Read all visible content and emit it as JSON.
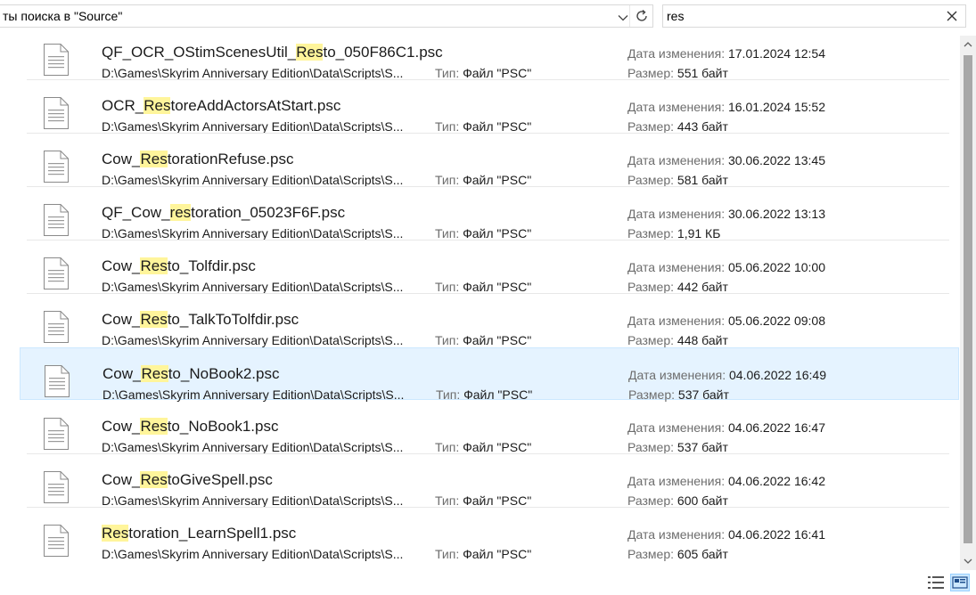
{
  "address": {
    "text": "ты поиска в \"Source\""
  },
  "search": {
    "value": "res"
  },
  "labels": {
    "date": "Дата изменения:",
    "size": "Размер:",
    "type": "Тип:"
  },
  "files": [
    {
      "name_pre": "QF_OCR_OStimScenesUtil_",
      "name_hl": "Res",
      "name_post": "to_050F86C1.psc",
      "path": "D:\\Games\\Skyrim Anniversary Edition\\Data\\Scripts\\S...",
      "type": "Файл \"PSC\"",
      "date": "17.01.2024 12:54",
      "size": "551 байт"
    },
    {
      "name_pre": "OCR_",
      "name_hl": "Res",
      "name_post": "toreAddActorsAtStart.psc",
      "path": "D:\\Games\\Skyrim Anniversary Edition\\Data\\Scripts\\S...",
      "type": "Файл \"PSC\"",
      "date": "16.01.2024 15:52",
      "size": "443 байт"
    },
    {
      "name_pre": "Cow_",
      "name_hl": "Res",
      "name_post": "torationRefuse.psc",
      "path": "D:\\Games\\Skyrim Anniversary Edition\\Data\\Scripts\\S...",
      "type": "Файл \"PSC\"",
      "date": "30.06.2022 13:45",
      "size": "581 байт"
    },
    {
      "name_pre": "QF_Cow_",
      "name_hl": "res",
      "name_post": "toration_05023F6F.psc",
      "path": "D:\\Games\\Skyrim Anniversary Edition\\Data\\Scripts\\S...",
      "type": "Файл \"PSC\"",
      "date": "30.06.2022 13:13",
      "size": "1,91 КБ"
    },
    {
      "name_pre": "Cow_",
      "name_hl": "Res",
      "name_post": "to_Tolfdir.psc",
      "path": "D:\\Games\\Skyrim Anniversary Edition\\Data\\Scripts\\S...",
      "type": "Файл \"PSC\"",
      "date": "05.06.2022 10:00",
      "size": "442 байт"
    },
    {
      "name_pre": "Cow_",
      "name_hl": "Res",
      "name_post": "to_TalkToTolfdir.psc",
      "path": "D:\\Games\\Skyrim Anniversary Edition\\Data\\Scripts\\S...",
      "type": "Файл \"PSC\"",
      "date": "05.06.2022 09:08",
      "size": "448 байт"
    },
    {
      "name_pre": "Cow_",
      "name_hl": "Res",
      "name_post": "to_NoBook2.psc",
      "path": "D:\\Games\\Skyrim Anniversary Edition\\Data\\Scripts\\S...",
      "type": "Файл \"PSC\"",
      "date": "04.06.2022 16:49",
      "size": "537 байт",
      "selected": true
    },
    {
      "name_pre": "Cow_",
      "name_hl": "Res",
      "name_post": "to_NoBook1.psc",
      "path": "D:\\Games\\Skyrim Anniversary Edition\\Data\\Scripts\\S...",
      "type": "Файл \"PSC\"",
      "date": "04.06.2022 16:47",
      "size": "537 байт"
    },
    {
      "name_pre": "Cow_",
      "name_hl": "Res",
      "name_post": "toGiveSpell.psc",
      "path": "D:\\Games\\Skyrim Anniversary Edition\\Data\\Scripts\\S...",
      "type": "Файл \"PSC\"",
      "date": "04.06.2022 16:42",
      "size": "600 байт"
    },
    {
      "name_pre": "",
      "name_hl": "Res",
      "name_post": "toration_LearnSpell1.psc",
      "path": "D:\\Games\\Skyrim Anniversary Edition\\Data\\Scripts\\S...",
      "type": "Файл \"PSC\"",
      "date": "04.06.2022 16:41",
      "size": "605 байт"
    }
  ],
  "icons": {
    "address_dropdown": "chevron-down-icon",
    "refresh": "refresh-icon",
    "clear": "close-icon",
    "file": "document-icon",
    "view_details": "details-view-icon",
    "view_tiles": "tiles-view-icon"
  },
  "colors": {
    "highlight": "#fff59b",
    "selection_bg": "#e5f3ff",
    "selection_border": "#cce8ff",
    "label_gray": "#6d6d6d"
  }
}
